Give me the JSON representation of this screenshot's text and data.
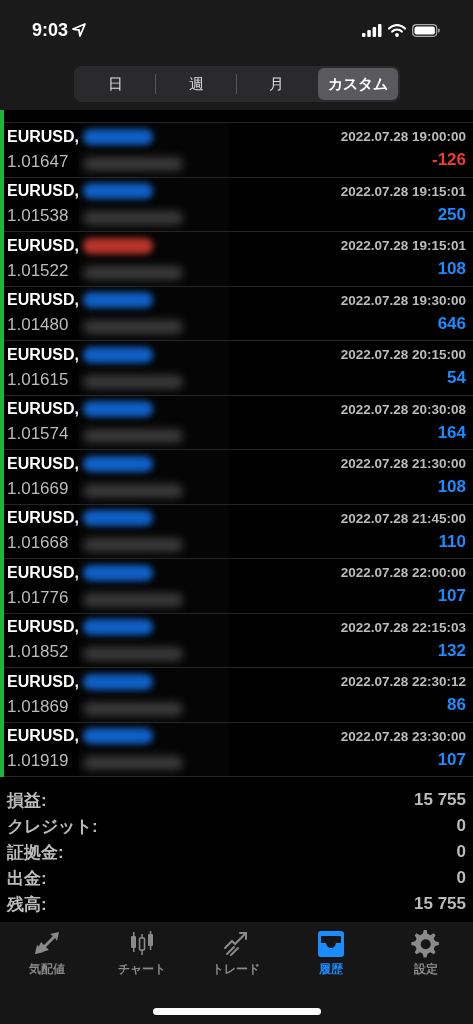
{
  "status_bar": {
    "time": "9:03"
  },
  "period_tabs": [
    {
      "label": "日",
      "selected": false
    },
    {
      "label": "週",
      "selected": false
    },
    {
      "label": "月",
      "selected": false
    },
    {
      "label": "カスタム",
      "selected": true
    }
  ],
  "deals": [
    {
      "symbol": "EURUSD,",
      "price": "1.01647",
      "time": "2022.07.28 19:00:00",
      "profit": "-126",
      "loss": true,
      "color": "#0f5fc4"
    },
    {
      "symbol": "EURUSD,",
      "price": "1.01538",
      "time": "2022.07.28 19:15:01",
      "profit": "250",
      "loss": false,
      "color": "#0f5fc4"
    },
    {
      "symbol": "EURUSD,",
      "price": "1.01522",
      "time": "2022.07.28 19:15:01",
      "profit": "108",
      "loss": false,
      "color": "#b8352a"
    },
    {
      "symbol": "EURUSD,",
      "price": "1.01480",
      "time": "2022.07.28 19:30:00",
      "profit": "646",
      "loss": false,
      "color": "#0f5fc4"
    },
    {
      "symbol": "EURUSD,",
      "price": "1.01615",
      "time": "2022.07.28 20:15:00",
      "profit": "54",
      "loss": false,
      "color": "#0f5fc4"
    },
    {
      "symbol": "EURUSD,",
      "price": "1.01574",
      "time": "2022.07.28 20:30:08",
      "profit": "164",
      "loss": false,
      "color": "#0f5fc4"
    },
    {
      "symbol": "EURUSD,",
      "price": "1.01669",
      "time": "2022.07.28 21:30:00",
      "profit": "108",
      "loss": false,
      "color": "#0f5fc4"
    },
    {
      "symbol": "EURUSD,",
      "price": "1.01668",
      "time": "2022.07.28 21:45:00",
      "profit": "110",
      "loss": false,
      "color": "#0f5fc4"
    },
    {
      "symbol": "EURUSD,",
      "price": "1.01776",
      "time": "2022.07.28 22:00:00",
      "profit": "107",
      "loss": false,
      "color": "#0f5fc4"
    },
    {
      "symbol": "EURUSD,",
      "price": "1.01852",
      "time": "2022.07.28 22:15:03",
      "profit": "132",
      "loss": false,
      "color": "#0f5fc4"
    },
    {
      "symbol": "EURUSD,",
      "price": "1.01869",
      "time": "2022.07.28 22:30:12",
      "profit": "86",
      "loss": false,
      "color": "#0f5fc4"
    },
    {
      "symbol": "EURUSD,",
      "price": "1.01919",
      "time": "2022.07.28 23:30:00",
      "profit": "107",
      "loss": false,
      "color": "#0f5fc4"
    }
  ],
  "summary": [
    {
      "label": "損益:",
      "value": "15 755"
    },
    {
      "label": "クレジット:",
      "value": "0"
    },
    {
      "label": "証拠金:",
      "value": "0"
    },
    {
      "label": "出金:",
      "value": "0"
    },
    {
      "label": "残高:",
      "value": "15 755"
    }
  ],
  "tab_bar": [
    {
      "kind": "quotes",
      "label": "気配値",
      "selected": false
    },
    {
      "kind": "chart",
      "label": "チャート",
      "selected": false
    },
    {
      "kind": "trade",
      "label": "トレード",
      "selected": false
    },
    {
      "kind": "history",
      "label": "履歴",
      "selected": true
    },
    {
      "kind": "settings",
      "label": "設定",
      "selected": false
    }
  ]
}
